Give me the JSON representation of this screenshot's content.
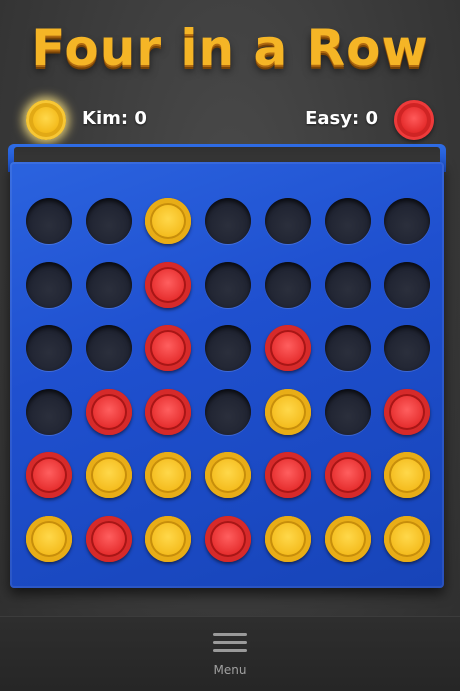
{
  "title": "Four in a Row",
  "players": {
    "left": {
      "name": "Kim:",
      "score": "0",
      "color": "#f4bb1c"
    },
    "right": {
      "name": "Easy:",
      "score": "0",
      "color": "#e52c2c"
    }
  },
  "board": {
    "rows": [
      [
        "empty",
        "empty",
        "yellow",
        "empty",
        "empty",
        "empty",
        "empty"
      ],
      [
        "empty",
        "empty",
        "red",
        "empty",
        "empty",
        "empty",
        "empty"
      ],
      [
        "empty",
        "empty",
        "red",
        "empty",
        "red",
        "empty",
        "empty"
      ],
      [
        "empty",
        "red",
        "red",
        "empty",
        "yellow",
        "empty",
        "red"
      ],
      [
        "red",
        "yellow",
        "yellow",
        "yellow",
        "red",
        "red",
        "yellow"
      ],
      [
        "yellow",
        "red",
        "yellow",
        "red",
        "yellow",
        "yellow",
        "yellow"
      ]
    ]
  },
  "footer": {
    "menu_label": "Menu",
    "menu_icon": "hamburger-icon"
  }
}
